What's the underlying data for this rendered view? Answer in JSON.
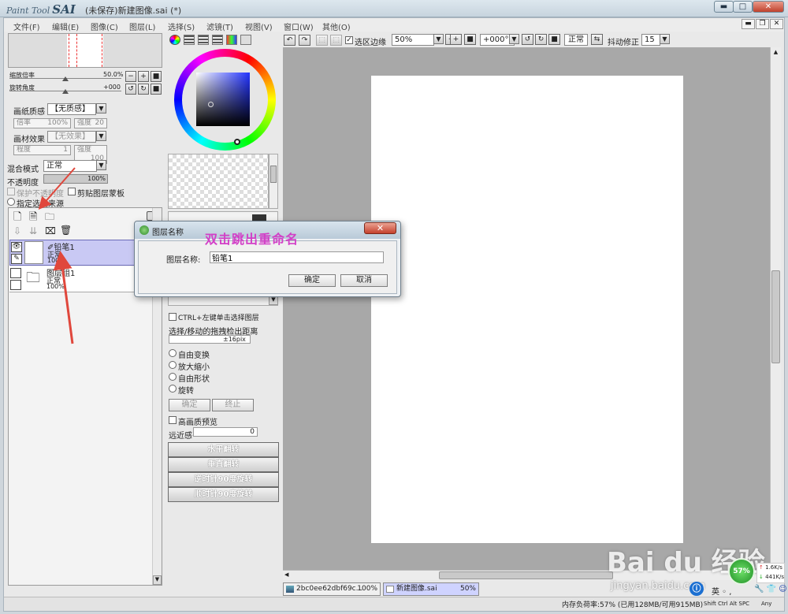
{
  "window": {
    "logo_text": "Paint Tool",
    "logo_bold": "SAI",
    "title": "(未保存)新建图像.sai (*)",
    "btn_min": "▬",
    "btn_max": "□",
    "btn_close": "✕"
  },
  "menu": {
    "items": [
      "文件(F)",
      "编辑(E)",
      "图像(C)",
      "图层(L)",
      "选择(S)",
      "滤镜(T)",
      "视图(V)",
      "窗口(W)",
      "其他(O)"
    ]
  },
  "navigator": {
    "zoom_label": "缩放倍率",
    "zoom_value": "50.0%",
    "zoom_fraction": 0.5,
    "rotate_label": "旋转角度",
    "rotate_value": "+000",
    "rotate_fraction": 0.5
  },
  "layer_props": {
    "paper_label": "画纸质感",
    "paper_value": "【无质感】",
    "scale_label": "倍率",
    "scale_value": "100%",
    "strength_label": "强度",
    "strength_value": "20",
    "effect_label": "画材效果",
    "effect_value": "【无效果】",
    "degree_label": "程度",
    "degree_value": "1",
    "strength2_value": "100",
    "blend_label": "混合模式",
    "blend_value": "正常",
    "opacity_label": "不透明度",
    "opacity_value": "100%",
    "opacity_fraction": 1.0,
    "protect_label": "保护不透明度",
    "clip_label": "剪贴图层蒙板",
    "source_label": "指定选区来源"
  },
  "layers": {
    "items": [
      {
        "name": "铅笔1",
        "mode": "正常",
        "opacity": "100%",
        "selected": true
      },
      {
        "name": "图层组1",
        "mode": "正常",
        "opacity": "100%",
        "selected": false
      }
    ]
  },
  "color_panel": {
    "colors": {
      "accent": "#3a5bd8",
      "hue": "#2233ff"
    }
  },
  "tool_options": {
    "ctrl_label": "CTRL+左键单击选择图层",
    "drag_label": "选择/移动的拖拽检出距离",
    "drag_value": "±16pix",
    "opt1": "自由变换",
    "opt2": "放大缩小",
    "opt3": "自由形状",
    "opt4": "旋转",
    "confirm": "确定",
    "cancel": "终止",
    "hq_label": "高画质预览",
    "perspective_label": "远近感",
    "perspective_value": "0",
    "flip_h": "水平翻转",
    "flip_v": "垂直翻转",
    "rot_ccw": "逆时针90度旋转",
    "rot_cw": "顺时针90度旋转"
  },
  "canvas_toolbar": {
    "select_edge": "选区边缘",
    "zoom": "50%",
    "angle": "+000°",
    "mode": "正常",
    "stabilizer_label": "抖动修正",
    "stabilizer_value": "15"
  },
  "dialog": {
    "title": "图层名称",
    "field_label": "图层名称:",
    "field_value": "铅笔1",
    "ok": "确定",
    "cancel": "取消"
  },
  "annotation": {
    "text": "双击跳出重命名"
  },
  "doctabs": [
    {
      "name": "2bc0ee62dbf69c...",
      "zoom": "100%"
    },
    {
      "name": "新建图像.sai",
      "zoom": "50%"
    }
  ],
  "status": {
    "memory": "内存负荷率:57% (已用128MB/可用915MB)",
    "keys": "Shift Ctrl Alt SPC",
    "any": "Any"
  },
  "watermark": {
    "brand": "Bai du 经验",
    "sub": "jingyan.baidu.com"
  },
  "net": {
    "percent": "57%",
    "up": "1.6K/s",
    "down": "441K/s"
  }
}
